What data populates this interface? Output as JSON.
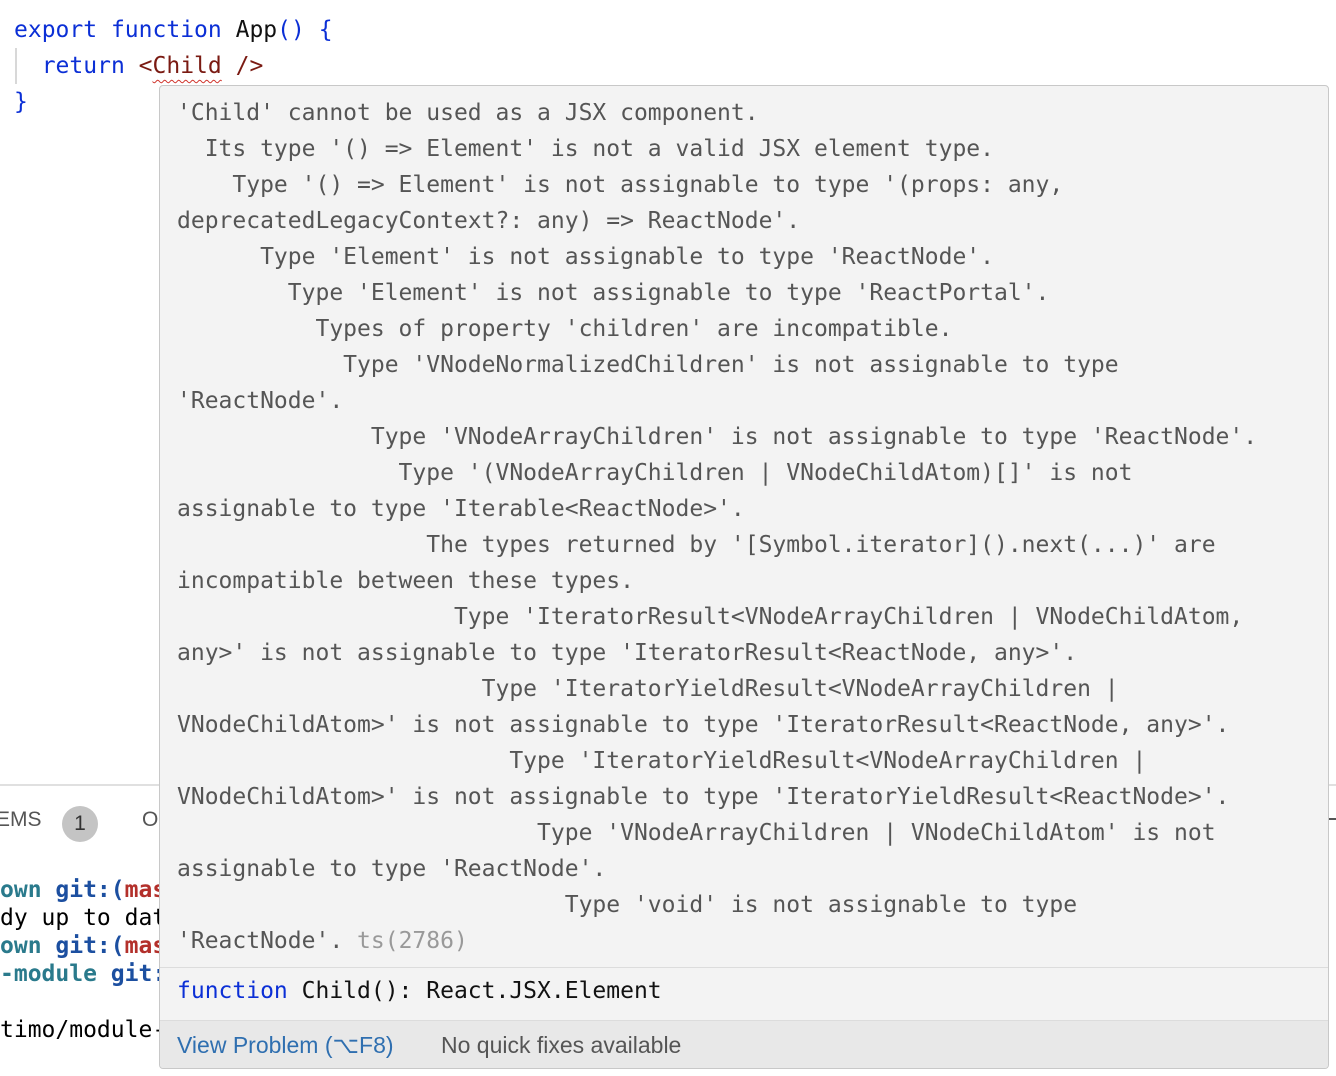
{
  "editor": {
    "line1": {
      "kw1": "export",
      "kw2": "function",
      "name": "App",
      "parens": "()",
      "brace": "{"
    },
    "line2": {
      "kw": "return",
      "open": "<",
      "tag": "Child",
      "close": " />"
    },
    "line3": {
      "brace": "}"
    }
  },
  "panel": {
    "tab_problems": "EMS",
    "problem_count": "1",
    "tab_output": "O",
    "terminal": [
      {
        "a": "own",
        "b": " git:(",
        "c": "mas"
      },
      {
        "plain": "dy up to dat"
      },
      {
        "a": "own",
        "b": " git:(",
        "c": "mas"
      },
      {
        "a": "-module",
        "b": " git:"
      },
      {
        "plain": ""
      },
      {
        "plain": "timo/module-"
      }
    ]
  },
  "hover": {
    "message_lines": [
      "'Child' cannot be used as a JSX component.",
      "  Its type '() => Element' is not a valid JSX element type.",
      "    Type '() => Element' is not assignable to type '(props: any,",
      "deprecatedLegacyContext?: any) => ReactNode'.",
      "      Type 'Element' is not assignable to type 'ReactNode'.",
      "        Type 'Element' is not assignable to type 'ReactPortal'.",
      "          Types of property 'children' are incompatible.",
      "            Type 'VNodeNormalizedChildren' is not assignable to type",
      "'ReactNode'.",
      "              Type 'VNodeArrayChildren' is not assignable to type 'ReactNode'.",
      "                Type '(VNodeArrayChildren | VNodeChildAtom)[]' is not",
      "assignable to type 'Iterable<ReactNode>'.",
      "                  The types returned by '[Symbol.iterator]().next(...)' are",
      "incompatible between these types.",
      "                    Type 'IteratorResult<VNodeArrayChildren | VNodeChildAtom,",
      "any>' is not assignable to type 'IteratorResult<ReactNode, any>'.",
      "                      Type 'IteratorYieldResult<VNodeArrayChildren |",
      "VNodeChildAtom>' is not assignable to type 'IteratorResult<ReactNode, any>'.",
      "                        Type 'IteratorYieldResult<VNodeArrayChildren |",
      "VNodeChildAtom>' is not assignable to type 'IteratorYieldResult<ReactNode>'.",
      "                          Type 'VNodeArrayChildren | VNodeChildAtom' is not",
      "assignable to type 'ReactNode'.",
      "                            Type 'void' is not assignable to type"
    ],
    "last_line": "'ReactNode'.",
    "error_code": "ts(2786)",
    "signature": {
      "kw": "function",
      "rest": " Child(): React.JSX.Element"
    },
    "view_problem": "View Problem (⌥F8)",
    "no_quick_fixes": "No quick fixes available"
  }
}
